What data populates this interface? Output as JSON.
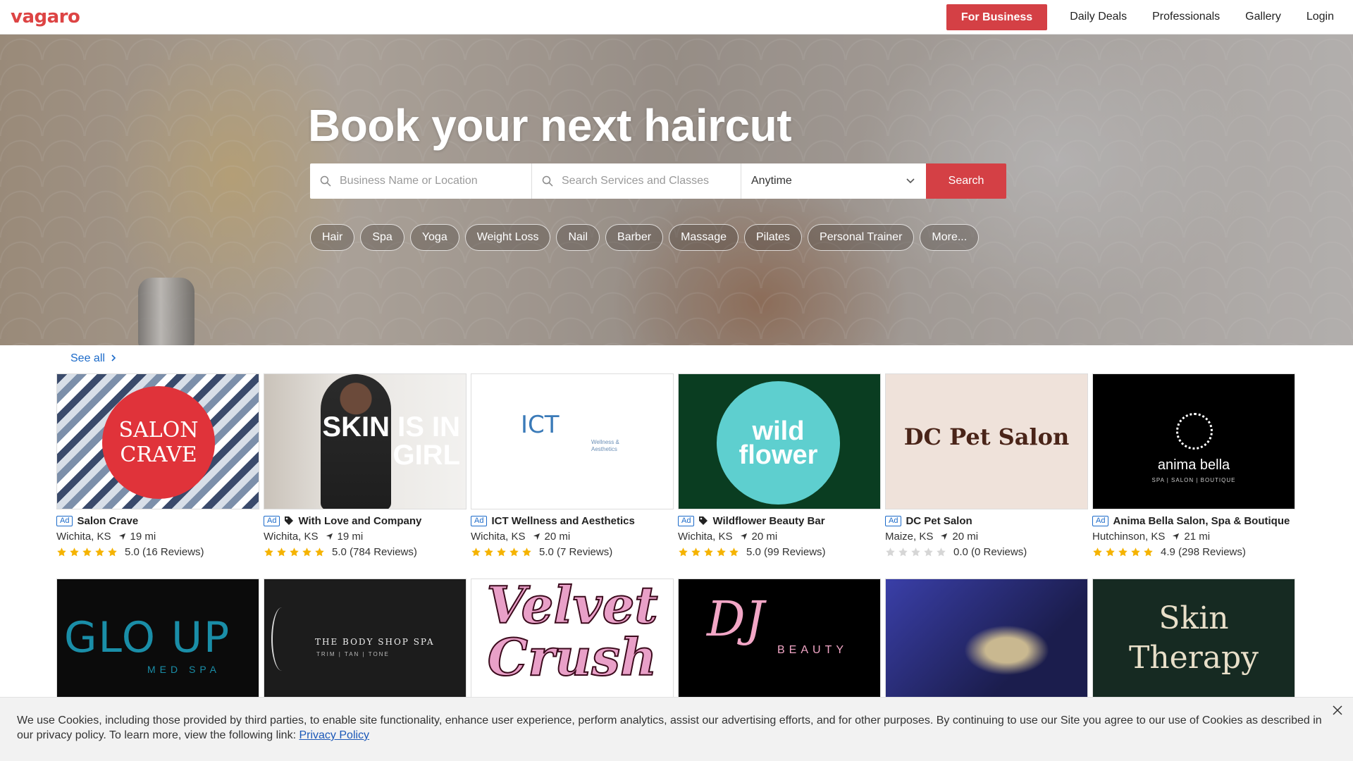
{
  "header": {
    "logo": "vagaro",
    "for_business": "For Business",
    "links": [
      "Daily Deals",
      "Professionals",
      "Gallery",
      "Login"
    ]
  },
  "hero": {
    "title": "Book your next haircut",
    "search": {
      "location_placeholder": "Business Name or Location",
      "services_placeholder": "Search Services and Classes",
      "when_value": "Anytime",
      "button": "Search"
    },
    "chips": [
      "Hair",
      "Spa",
      "Yoga",
      "Weight Loss",
      "Nail",
      "Barber",
      "Massage",
      "Pilates",
      "Personal Trainer",
      "More..."
    ]
  },
  "listings": {
    "see_all": "See all",
    "ad_label": "Ad",
    "cards": [
      {
        "name": "Salon Crave",
        "city": "Wichita, KS",
        "distance": "19 mi",
        "rating": 5.0,
        "rating_text": "5.0 (16 Reviews)",
        "tag": false,
        "art": "SALON CRAVE"
      },
      {
        "name": "With Love and Company",
        "city": "Wichita, KS",
        "distance": "19 mi",
        "rating": 5.0,
        "rating_text": "5.0 (784 Reviews)",
        "tag": true,
        "art": "SKIN IS IN GIRL"
      },
      {
        "name": "ICT Wellness and Aesthetics",
        "city": "Wichita, KS",
        "distance": "20 mi",
        "rating": 5.0,
        "rating_text": "5.0 (7 Reviews)",
        "tag": false,
        "art": "ICT"
      },
      {
        "name": "Wildflower Beauty Bar",
        "city": "Wichita, KS",
        "distance": "20 mi",
        "rating": 5.0,
        "rating_text": "5.0 (99 Reviews)",
        "tag": true,
        "art": "wild flower"
      },
      {
        "name": "DC Pet Salon",
        "city": "Maize, KS",
        "distance": "20 mi",
        "rating": 0.0,
        "rating_text": "0.0 (0 Reviews)",
        "tag": false,
        "art": "DC Pet Salon"
      },
      {
        "name": "Anima Bella Salon, Spa & Boutique",
        "city": "Hutchinson, KS",
        "distance": "21 mi",
        "rating": 4.9,
        "rating_text": "4.9 (298 Reviews)",
        "tag": false,
        "art": "anima bella"
      }
    ],
    "row2_art": [
      {
        "main": "GLO UP",
        "sub": "MED SPA"
      },
      {
        "main": "THE BODY SHOP SPA",
        "sub": "TRIM | TAN | TONE"
      },
      {
        "main": "Velvet Crush",
        "sub": ""
      },
      {
        "main": "DJ",
        "sub": "BEAUTY"
      },
      {
        "main": "",
        "sub": ""
      },
      {
        "main": "Skin Therapy",
        "sub": ""
      }
    ]
  },
  "cookie": {
    "text": "We use Cookies, including those provided by third parties, to enable site functionality, enhance user experience, perform analytics, assist our advertising efforts, and for other purposes. By continuing to use our Site you agree to our use of Cookies as described in our privacy policy. To learn more, view the following link: ",
    "link": "Privacy Policy"
  },
  "colors": {
    "brand": "#d44045",
    "link": "#1b6ac9",
    "star": "#f5b301",
    "star_empty": "#d6d6d6"
  }
}
